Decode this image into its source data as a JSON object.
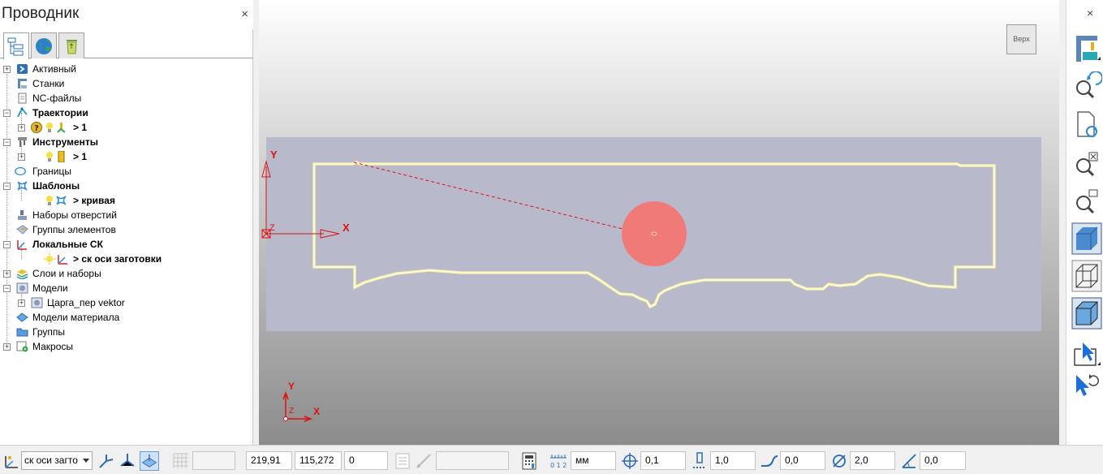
{
  "explorer": {
    "title": "Проводник",
    "close_glyph": "×",
    "tabs": [
      {
        "name": "tree-tab",
        "icon": "tree-view-icon"
      },
      {
        "name": "globe-tab",
        "icon": "globe-icon"
      },
      {
        "name": "bin-tab",
        "icon": "recycle-bin-icon"
      }
    ],
    "tree": {
      "active": "Активный",
      "machines": "Станки",
      "nc_files": "NC-файлы",
      "toolpaths": "Траектории",
      "toolpath_child": "> 1",
      "tools": "Инструменты",
      "tool_child": "> 1",
      "boundaries": "Границы",
      "patterns": "Шаблоны",
      "pattern_child": "> кривая",
      "hole_sets": "Наборы отверстий",
      "feature_groups": "Группы элементов",
      "local_cs": "Локальные СК",
      "local_cs_child": "> ск оси заготовки",
      "levels": "Слои и наборы",
      "models": "Модели",
      "model_child": "Царга_пер vektor",
      "stock_models": "Модели материала",
      "groups": "Группы",
      "macros": "Макросы"
    }
  },
  "viewport": {
    "view_cube_label": "Верх",
    "axis_x": "X",
    "axis_y": "Y",
    "axis_z": "Z",
    "colors": {
      "stock_box": "#b9b9cc",
      "outline": "#f5f0a0",
      "axis": "#e01010",
      "tool_disc": "#f07a78"
    }
  },
  "right_toolbar": {
    "close_glyph": "×",
    "buttons": [
      "machine-icon",
      "zoom-rotate-icon",
      "refresh-document-icon",
      "zoom-fit-icon",
      "zoom-box-icon",
      "shaded-view-icon",
      "wireframe-view-icon",
      "shaded-wireframe-view-icon",
      "select-icon",
      "select-undo-icon"
    ]
  },
  "statusbar": {
    "workplane": "ск оси загто",
    "x_value": "219,91",
    "y_value": "115,272",
    "z_value": "0",
    "units": "мм",
    "tolerance": "0,1",
    "tool_diameter_step": "1,0",
    "thickness": "0,0",
    "diameter": "2,0",
    "angle": "0,0"
  }
}
